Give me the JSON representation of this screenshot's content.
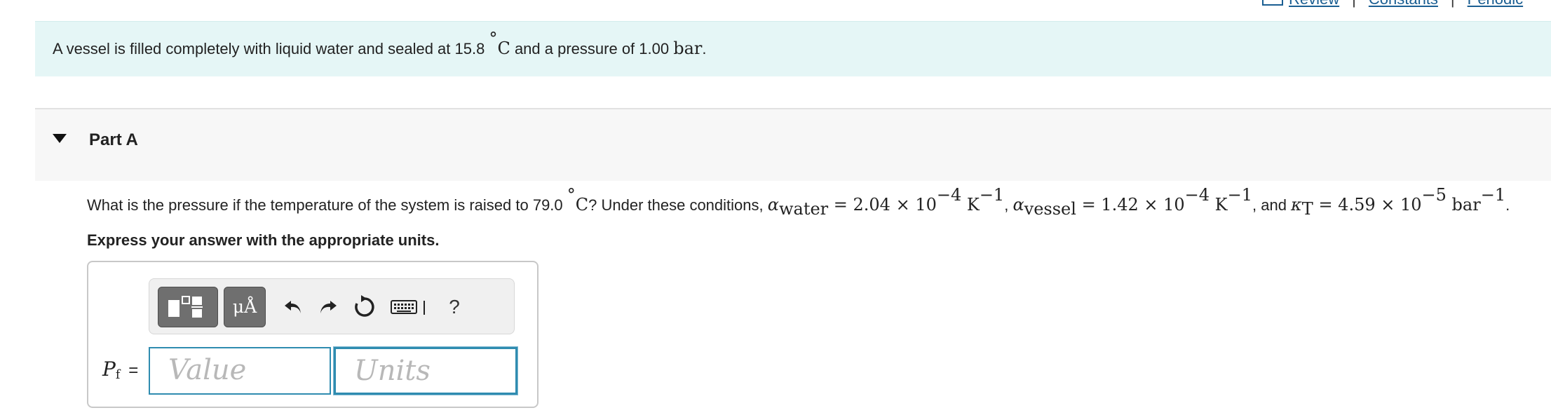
{
  "top_links": {
    "review": "Review",
    "separator": "|",
    "constants": "Constants",
    "periodic": "Periodic"
  },
  "intro": {
    "text_before": "A vessel is filled completely with liquid water and sealed at 15.8 ",
    "deg": "°",
    "temp_unit": "C",
    "text_mid": " and a pressure of 1.00 ",
    "pressure_unit": "bar",
    "text_end": "."
  },
  "part": {
    "title": "Part A"
  },
  "question": {
    "q1": "What is the pressure if the temperature of the system is raised to 79.0 ",
    "deg": "°",
    "unit_c": "C",
    "q2": "? Under these conditions, ",
    "alpha": "α",
    "sub_water": "water",
    "eq1": " = 2.04 × 10",
    "exp1": "−4",
    "k1": " K",
    "kexp1": "−1",
    "comma1": ", ",
    "alpha2": "α",
    "sub_vessel": "vessel",
    "eq2": " = 1.42 × 10",
    "exp2": "−4",
    "k2": " K",
    "kexp2": "−1",
    "and_text": ", and ",
    "kappa": "κ",
    "sub_t": "T",
    "eq3": " = 4.59 × 10",
    "exp3": "−5",
    "bar": " bar",
    "barexp": "−1",
    "end": "."
  },
  "instruction": "Express your answer with the appropriate units.",
  "toolbar": {
    "units_label": "μÅ",
    "help_label": "?"
  },
  "answer": {
    "label_var": "P",
    "label_sub": "f",
    "label_eq": "=",
    "value_placeholder": "Value",
    "units_placeholder": "Units"
  },
  "colors": {
    "intro_bg": "#e5f6f6",
    "part_bg": "#f7f7f7",
    "input_border": "#2f8cb0",
    "link": "#1a5e92"
  }
}
